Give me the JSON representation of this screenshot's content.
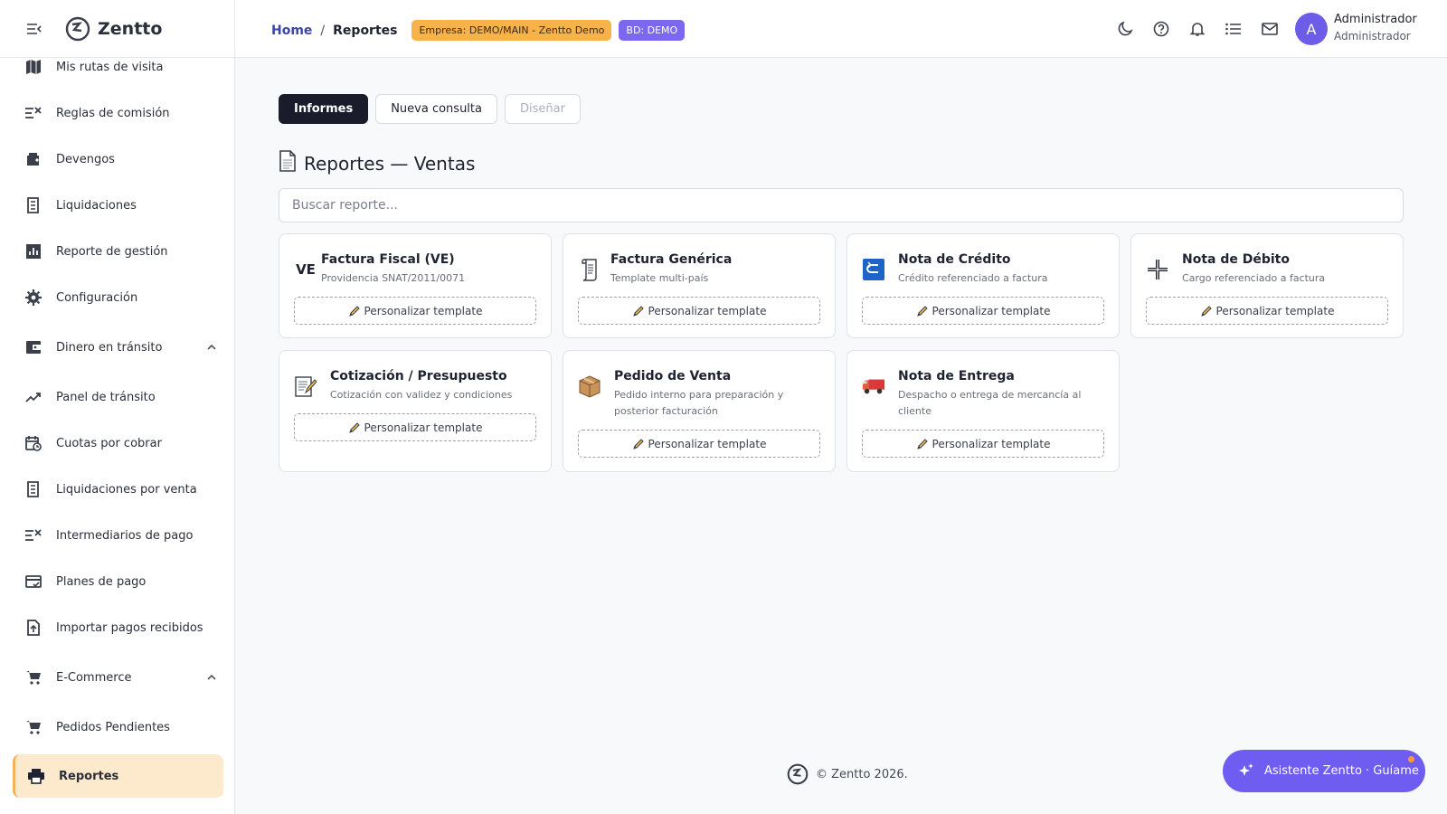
{
  "sidebar": {
    "brand": "Zentto",
    "items": [
      {
        "label": "Mis rutas de visita",
        "icon": "map-icon"
      },
      {
        "label": "Reglas de comisión",
        "icon": "rule-icon"
      },
      {
        "label": "Devengos",
        "icon": "wallet-icon"
      },
      {
        "label": "Liquidaciones",
        "icon": "receipt-icon"
      },
      {
        "label": "Reporte de gestión",
        "icon": "bar-chart-icon"
      },
      {
        "label": "Configuración",
        "icon": "gear-icon"
      },
      {
        "label": "Dinero en tránsito",
        "icon": "transit-icon"
      },
      {
        "label": "Panel de tránsito",
        "icon": "trend-icon"
      },
      {
        "label": "Cuotas por cobrar",
        "icon": "calendar-clock-icon"
      },
      {
        "label": "Liquidaciones por venta",
        "icon": "receipt-icon"
      },
      {
        "label": "Intermediarios de pago",
        "icon": "rule-icon"
      },
      {
        "label": "Planes de pago",
        "icon": "card-icon"
      },
      {
        "label": "Importar pagos recibidos",
        "icon": "upload-file-icon"
      },
      {
        "label": "E-Commerce",
        "icon": "cart-icon"
      },
      {
        "label": "Pedidos Pendientes",
        "icon": "cart-icon"
      },
      {
        "label": "Reportes",
        "icon": "printer-icon"
      }
    ]
  },
  "topbar": {
    "breadcrumb_home": "Home",
    "breadcrumb_sep": "/",
    "breadcrumb_current": "Reportes",
    "company_badge": "Empresa: DEMO/MAIN - Zentto Demo",
    "db_badge": "BD: DEMO",
    "user_name": "Administrador",
    "user_role": "Administrador",
    "avatar_letter": "A"
  },
  "tabs": [
    {
      "label": "Informes",
      "state": "active"
    },
    {
      "label": "Nueva consulta",
      "state": "normal"
    },
    {
      "label": "Diseñar",
      "state": "disabled"
    }
  ],
  "page_title": "Reportes — Ventas",
  "search": {
    "placeholder": "Buscar reporte..."
  },
  "cards": [
    {
      "title": "Factura Fiscal (VE)",
      "subtitle": "Providencia SNAT/2011/0071",
      "icon_text": "VE",
      "icon": "flag-ve-icon",
      "button": "Personalizar template"
    },
    {
      "title": "Factura Genérica",
      "subtitle": "Template multi-país",
      "icon": "scroll-icon",
      "button": "Personalizar template"
    },
    {
      "title": "Nota de Crédito",
      "subtitle": "Crédito referenciado a factura",
      "icon": "return-arrow-icon",
      "button": "Personalizar template"
    },
    {
      "title": "Nota de Débito",
      "subtitle": "Cargo referenciado a factura",
      "icon": "plus-icon",
      "button": "Personalizar template"
    },
    {
      "title": "Cotización / Presupuesto",
      "subtitle": "Cotización con validez y condiciones",
      "icon": "memo-icon",
      "button": "Personalizar template"
    },
    {
      "title": "Pedido de Venta",
      "subtitle": "Pedido interno para preparación y posterior facturación",
      "icon": "package-icon",
      "button": "Personalizar template"
    },
    {
      "title": "Nota de Entrega",
      "subtitle": "Despacho o entrega de mercancía al cliente",
      "icon": "truck-icon",
      "button": "Personalizar template"
    }
  ],
  "footer": "© Zentto 2026.",
  "assistant_label": "Asistente Zentto · Guíame",
  "colors": {
    "accent": "#6f5cf0",
    "active_tab": "#1a1c2c",
    "company_badge": "#f7b24a",
    "db_badge": "#7b68ee",
    "active_nav": "#fde9cc"
  }
}
